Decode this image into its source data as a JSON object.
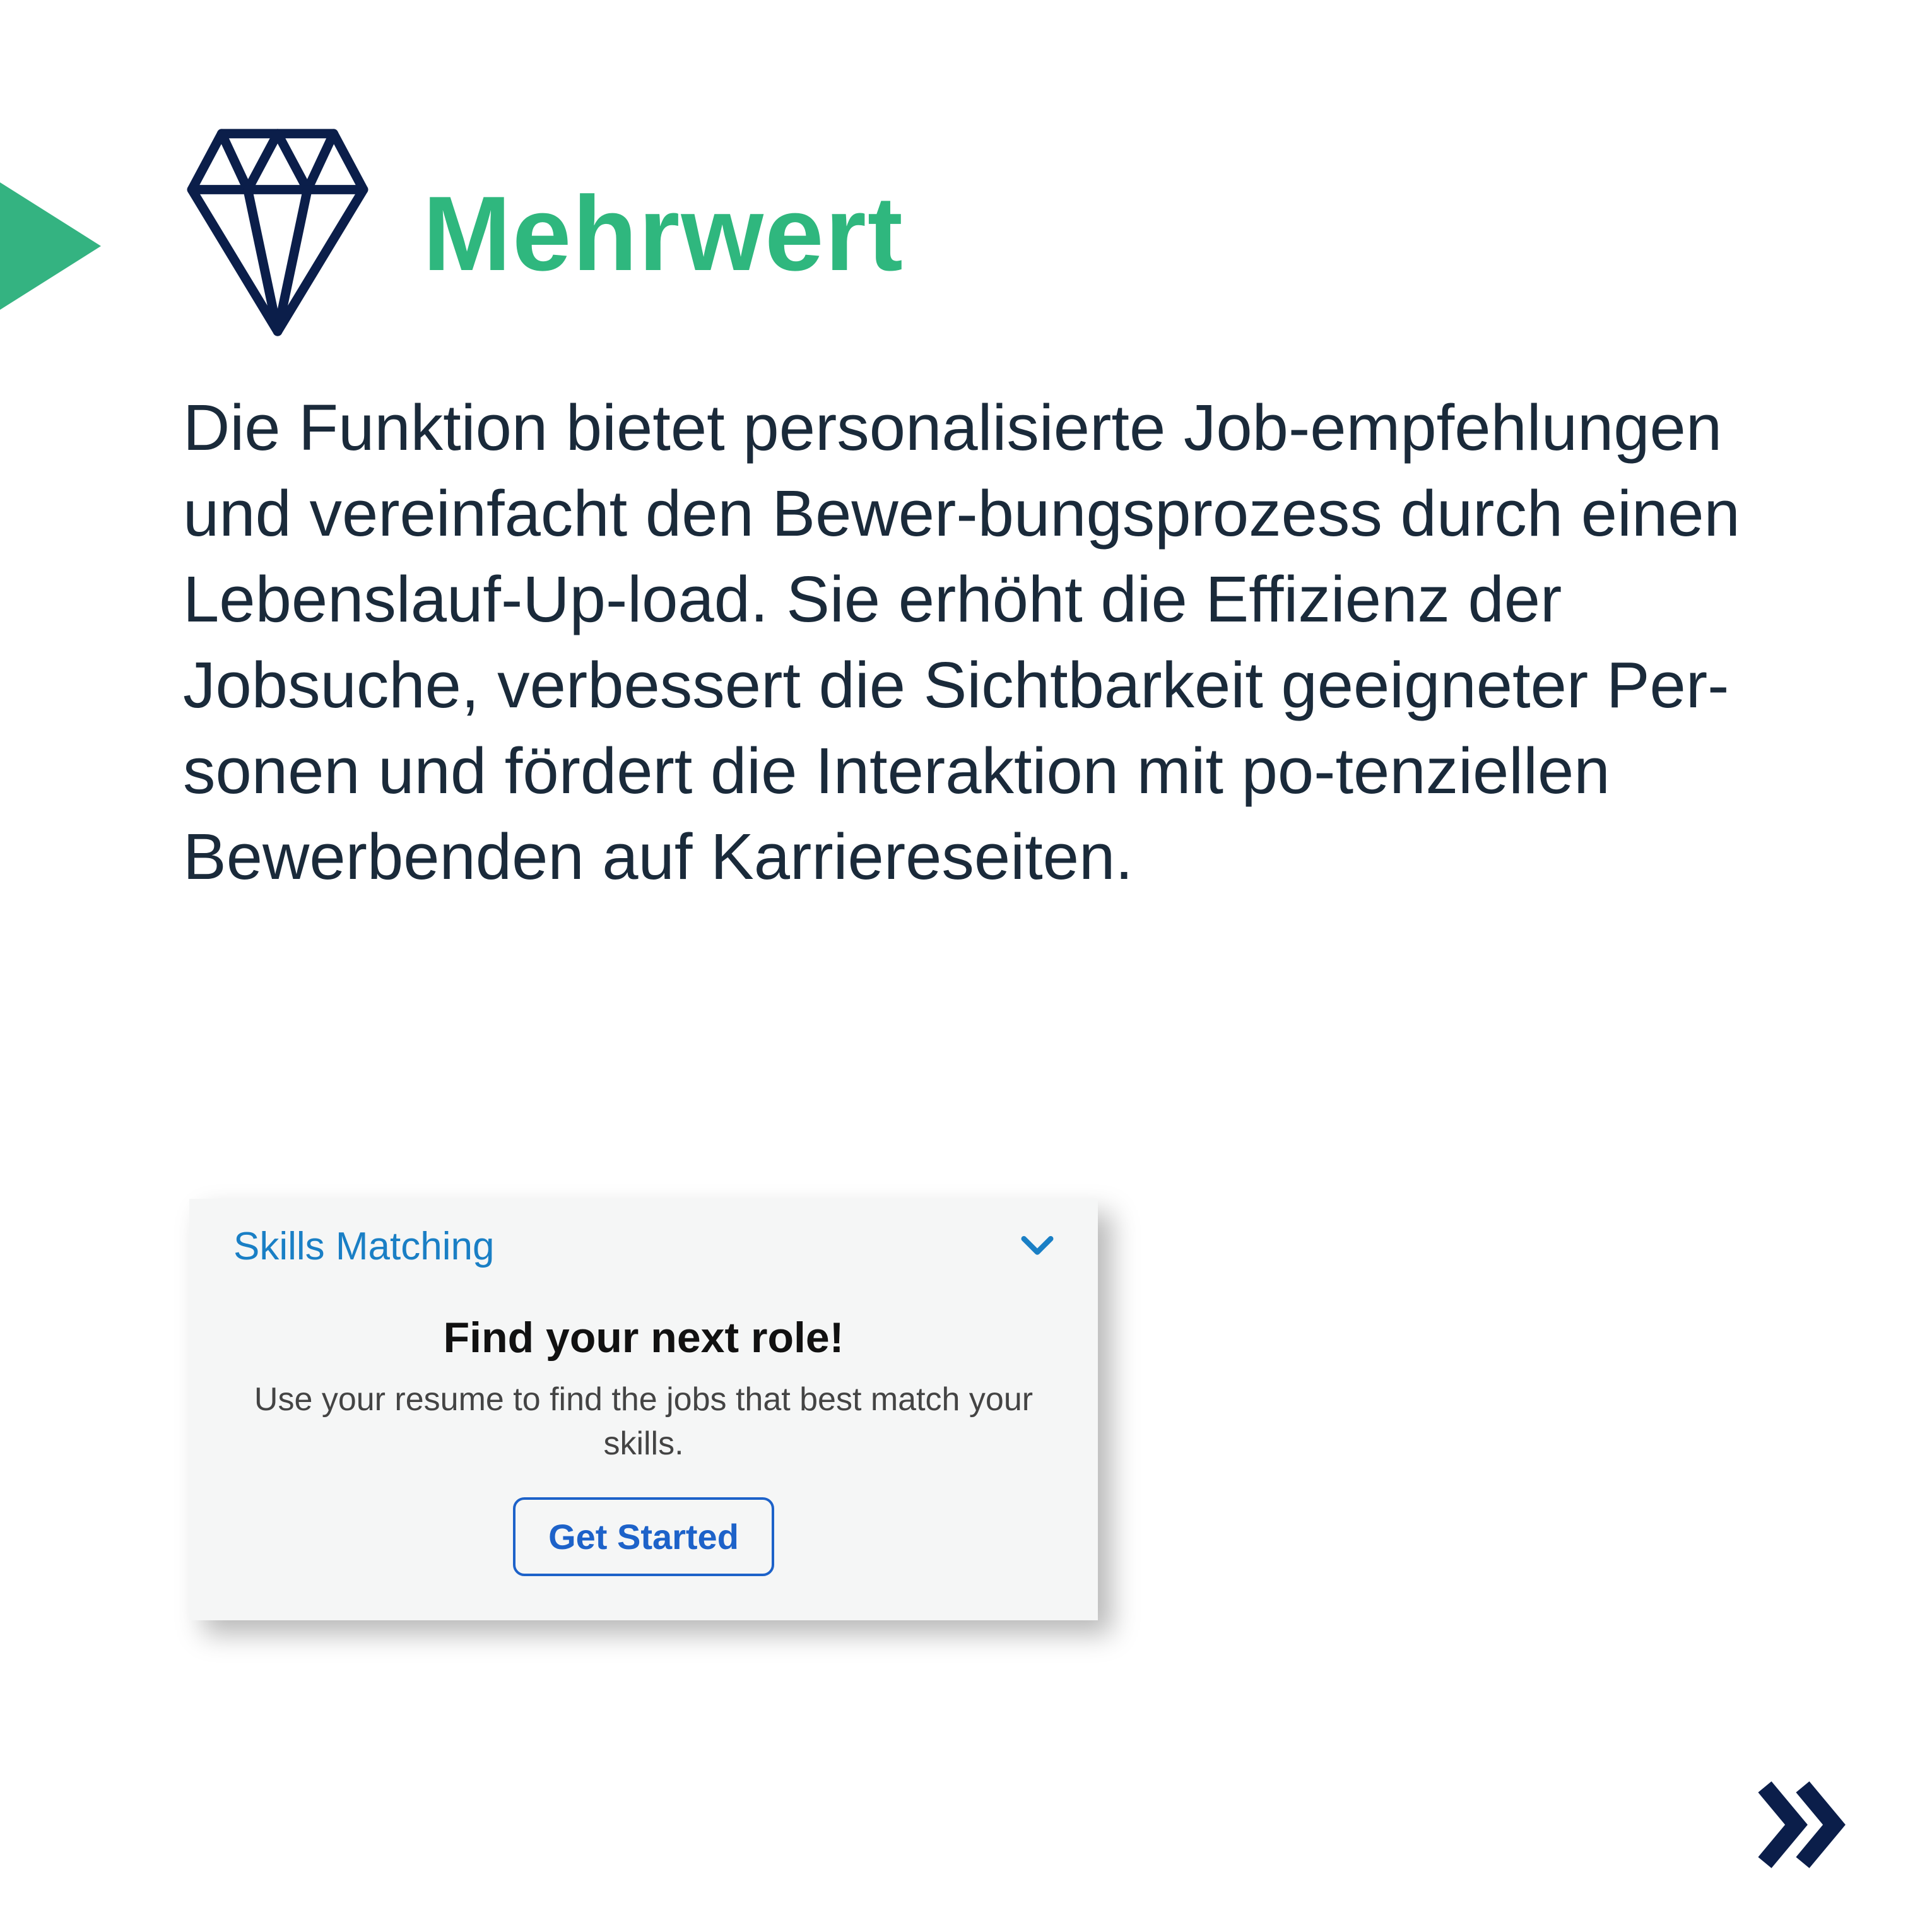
{
  "header": {
    "title": "Mehrwert",
    "icon": "diamond-icon"
  },
  "body": {
    "text": "Die Funktion bietet personalisierte Job-empfehlungen und vereinfacht den Bewer-bungsprozess durch einen Lebenslauf-Up-load. Sie erhöht die Effizienz der Jobsuche, verbessert die Sichtbarkeit geeigneter Per-sonen und fördert die Interaktion mit po-tenziellen Bewerbenden auf Karriereseiten."
  },
  "card": {
    "section_title": "Skills Matching",
    "heading": "Find your next role!",
    "subtext": "Use your resume to find the jobs that best match your skills.",
    "button_label": "Get Started",
    "chevron_icon": "chevron-down-icon"
  },
  "nav": {
    "next_icon": "double-chevron-right-icon"
  },
  "colors": {
    "navy": "#0b1e4a",
    "green": "#34b381",
    "link_blue": "#1a7fc5",
    "btn_blue": "#1d62c9"
  }
}
